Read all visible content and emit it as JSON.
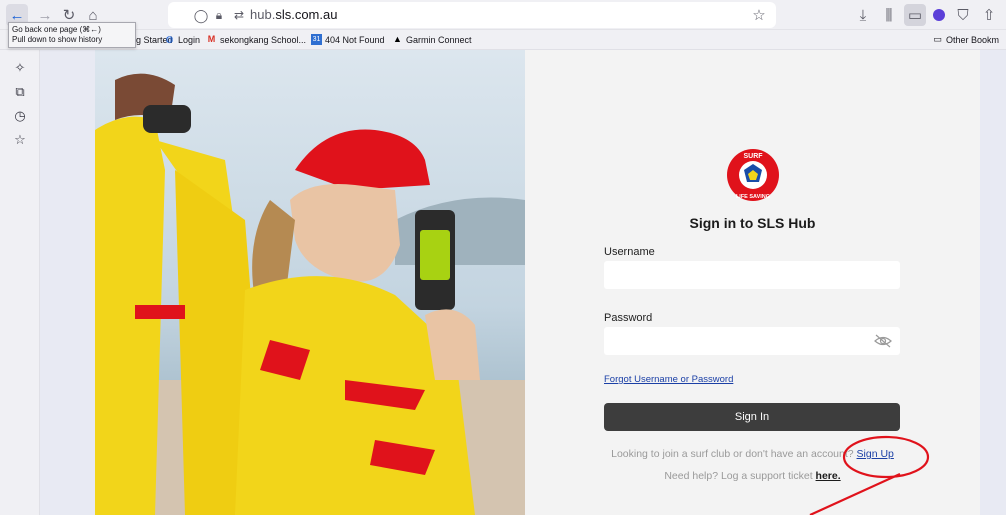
{
  "browser": {
    "url_domain_prefix": "hub.",
    "url_domain_main": "sls.com.au",
    "tooltip_line1": "Go back one page (⌘←)",
    "tooltip_line2": "Pull down to show history",
    "bookmarks": [
      {
        "label": "ng Started",
        "icon": "firefox-icon"
      },
      {
        "label": "Login",
        "icon": "globe-icon"
      },
      {
        "label": "sekongkang School...",
        "icon": "gmail-icon"
      },
      {
        "label": "404 Not Found",
        "icon": "calendar-icon"
      },
      {
        "label": "Garmin Connect",
        "icon": "garmin-icon"
      }
    ],
    "other_bookmarks": "Other Bookm"
  },
  "login": {
    "logo_top_text": "SURF",
    "logo_bottom_text": "LIFE SAVING",
    "title": "Sign in to SLS Hub",
    "username_label": "Username",
    "password_label": "Password",
    "forgot_link": "Forgot Username or Password",
    "signin_button": "Sign In",
    "join_text": "Looking to join a surf club or don't have an account?",
    "signup_link": "Sign Up",
    "help_text": "Need help? Log a support ticket",
    "help_link": "here."
  },
  "colors": {
    "accent_red": "#e0121b",
    "link_blue": "#1a3fa6",
    "button_dark": "#3d3d3d"
  }
}
